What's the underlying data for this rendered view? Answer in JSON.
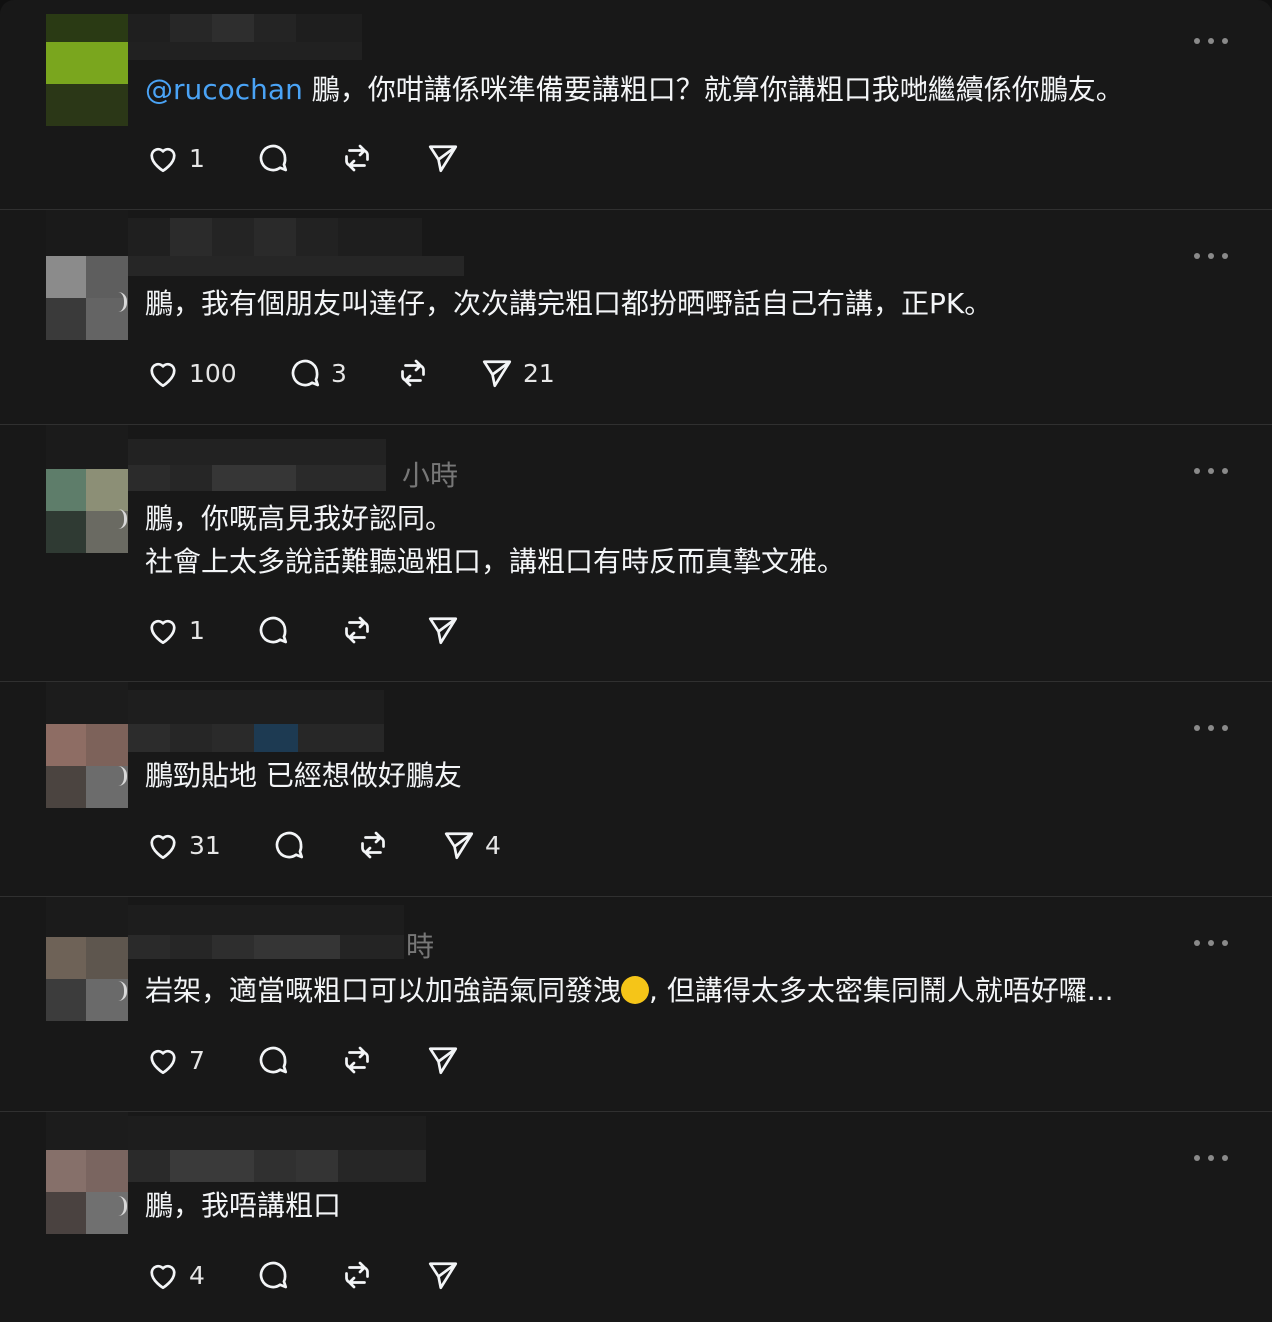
{
  "colors": {
    "background": "#181818",
    "text": "#f3f5f7",
    "mention": "#4aa3f5",
    "muted": "#777777",
    "divider": "#303030"
  },
  "icons": {
    "like": "heart-icon",
    "reply": "comment-bubble-icon",
    "repost": "repost-icon",
    "share": "send-icon",
    "more": "more-horizontal-icon"
  },
  "posts": [
    {
      "time": "",
      "mention": "@rucochan",
      "lines": [
        " 鵬，你咁講係咪準備要講粗口？就算你講粗口我哋繼續係你鵬友。"
      ],
      "likes": "1",
      "replies": "",
      "reposts": "",
      "shares": ""
    },
    {
      "time": "",
      "mention": "",
      "lines": [
        "鵬，我有個朋友叫達仔，次次講完粗口都扮晒嘢話自己冇講，正PK。"
      ],
      "likes": "100",
      "replies": "3",
      "reposts": "",
      "shares": "21"
    },
    {
      "time": "小時",
      "mention": "",
      "lines": [
        "鵬，你嘅高見我好認同。",
        "社會上太多說話難聽過粗口，講粗口有時反而真摯文雅。"
      ],
      "likes": "1",
      "replies": "",
      "reposts": "",
      "shares": ""
    },
    {
      "time": "",
      "mention": "",
      "lines": [
        "鵬勁貼地 已經想做好鵬友"
      ],
      "likes": "31",
      "replies": "",
      "reposts": "",
      "shares": "4"
    },
    {
      "time": "時",
      "mention": "",
      "lines": [
        "岩架，適當嘅粗口可以加強語氣同發洩",
        ", 但講得太多太密集同鬧人就唔好囉..."
      ],
      "likes": "7",
      "replies": "",
      "reposts": "",
      "shares": ""
    },
    {
      "time": "",
      "mention": "",
      "lines": [
        "鵬，我唔講粗口"
      ],
      "likes": "4",
      "replies": "",
      "reposts": "",
      "shares": ""
    }
  ]
}
